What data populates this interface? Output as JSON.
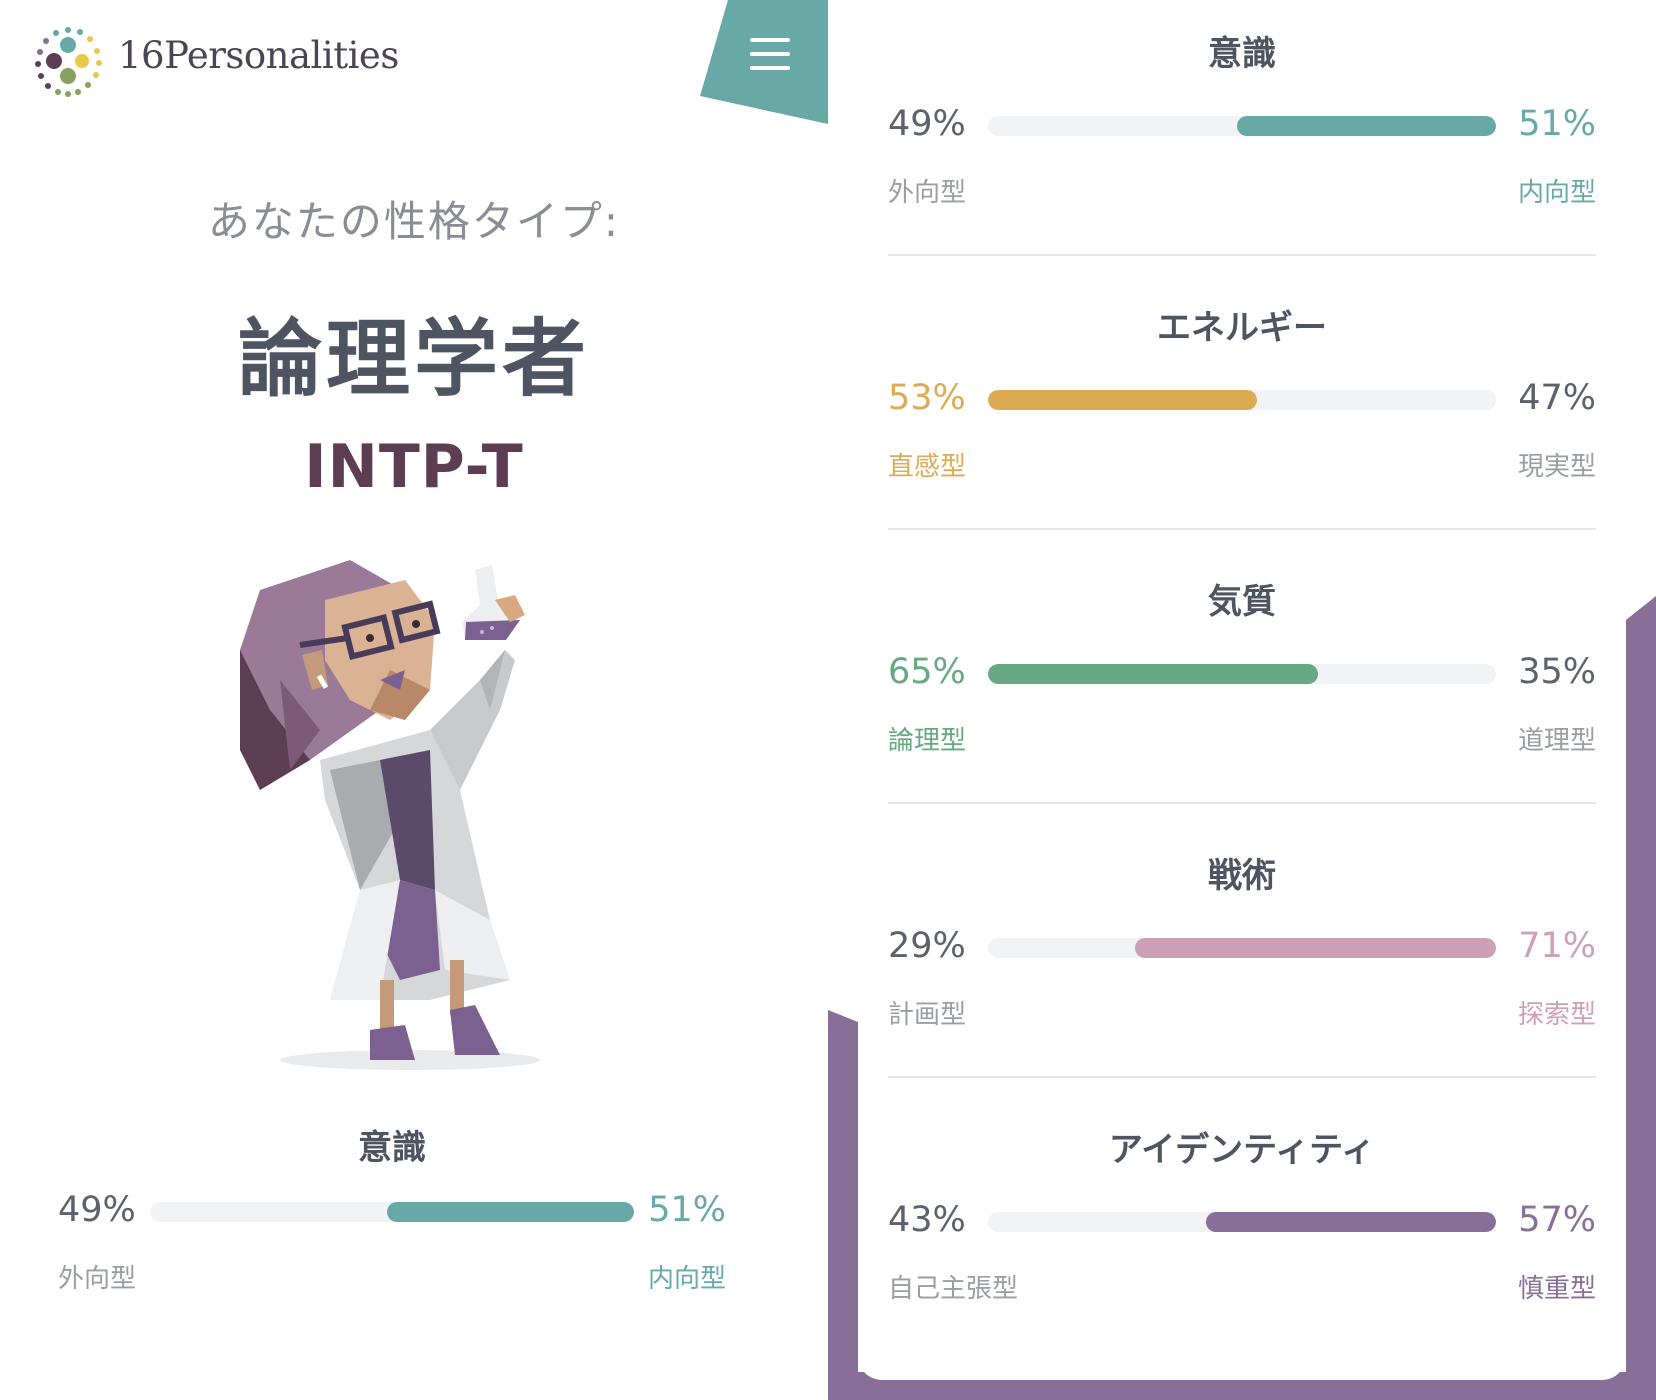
{
  "brand": {
    "name": "16Personalities"
  },
  "header": {
    "menu_icon": "hamburger-menu-icon"
  },
  "result": {
    "subtitle": "あなたの性格タイプ:",
    "type_name": "論理学者",
    "type_code": "INTP-T"
  },
  "left_trait": {
    "title": "意識",
    "left_pct": "49%",
    "right_pct": "51%",
    "left_label": "外向型",
    "right_label": "内向型",
    "value": 51,
    "side": "right",
    "color": "#68a9a8"
  },
  "traits": [
    {
      "title": "意識",
      "left_pct": "49%",
      "right_pct": "51%",
      "left_label": "外向型",
      "right_label": "内向型",
      "value": 51,
      "side": "right",
      "color": "#68a9a8"
    },
    {
      "title": "エネルギー",
      "left_pct": "53%",
      "right_pct": "47%",
      "left_label": "直感型",
      "right_label": "現実型",
      "value": 53,
      "side": "left",
      "color": "#ddab54"
    },
    {
      "title": "気質",
      "left_pct": "65%",
      "right_pct": "35%",
      "left_label": "論理型",
      "right_label": "道理型",
      "value": 65,
      "side": "left",
      "color": "#66a882"
    },
    {
      "title": "戦術",
      "left_pct": "29%",
      "right_pct": "71%",
      "left_label": "計画型",
      "right_label": "探索型",
      "value": 71,
      "side": "right",
      "color": "#cda0b5"
    },
    {
      "title": "アイデンティティ",
      "left_pct": "43%",
      "right_pct": "57%",
      "left_label": "自己主張型",
      "right_label": "慎重型",
      "value": 57,
      "side": "right",
      "color": "#876f97"
    }
  ],
  "colors": {
    "teal": "#68a9a8",
    "purple_bg": "#876f97",
    "heading": "#4f5461",
    "type_code": "#5c3d52"
  }
}
